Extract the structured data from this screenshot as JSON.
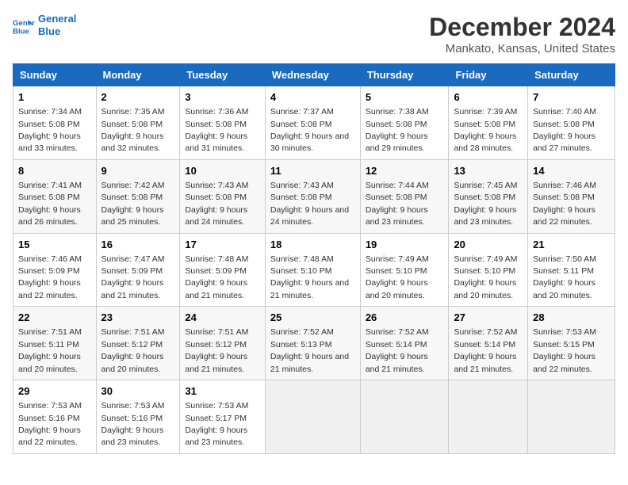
{
  "header": {
    "logo_line1": "General",
    "logo_line2": "Blue",
    "title": "December 2024",
    "subtitle": "Mankato, Kansas, United States"
  },
  "calendar": {
    "days_of_week": [
      "Sunday",
      "Monday",
      "Tuesday",
      "Wednesday",
      "Thursday",
      "Friday",
      "Saturday"
    ],
    "weeks": [
      [
        {
          "day": 1,
          "sunrise": "7:34 AM",
          "sunset": "5:08 PM",
          "daylight": "9 hours and 33 minutes."
        },
        {
          "day": 2,
          "sunrise": "7:35 AM",
          "sunset": "5:08 PM",
          "daylight": "9 hours and 32 minutes."
        },
        {
          "day": 3,
          "sunrise": "7:36 AM",
          "sunset": "5:08 PM",
          "daylight": "9 hours and 31 minutes."
        },
        {
          "day": 4,
          "sunrise": "7:37 AM",
          "sunset": "5:08 PM",
          "daylight": "9 hours and 30 minutes."
        },
        {
          "day": 5,
          "sunrise": "7:38 AM",
          "sunset": "5:08 PM",
          "daylight": "9 hours and 29 minutes."
        },
        {
          "day": 6,
          "sunrise": "7:39 AM",
          "sunset": "5:08 PM",
          "daylight": "9 hours and 28 minutes."
        },
        {
          "day": 7,
          "sunrise": "7:40 AM",
          "sunset": "5:08 PM",
          "daylight": "9 hours and 27 minutes."
        }
      ],
      [
        {
          "day": 8,
          "sunrise": "7:41 AM",
          "sunset": "5:08 PM",
          "daylight": "9 hours and 26 minutes."
        },
        {
          "day": 9,
          "sunrise": "7:42 AM",
          "sunset": "5:08 PM",
          "daylight": "9 hours and 25 minutes."
        },
        {
          "day": 10,
          "sunrise": "7:43 AM",
          "sunset": "5:08 PM",
          "daylight": "9 hours and 24 minutes."
        },
        {
          "day": 11,
          "sunrise": "7:43 AM",
          "sunset": "5:08 PM",
          "daylight": "9 hours and 24 minutes."
        },
        {
          "day": 12,
          "sunrise": "7:44 AM",
          "sunset": "5:08 PM",
          "daylight": "9 hours and 23 minutes."
        },
        {
          "day": 13,
          "sunrise": "7:45 AM",
          "sunset": "5:08 PM",
          "daylight": "9 hours and 23 minutes."
        },
        {
          "day": 14,
          "sunrise": "7:46 AM",
          "sunset": "5:08 PM",
          "daylight": "9 hours and 22 minutes."
        }
      ],
      [
        {
          "day": 15,
          "sunrise": "7:46 AM",
          "sunset": "5:09 PM",
          "daylight": "9 hours and 22 minutes."
        },
        {
          "day": 16,
          "sunrise": "7:47 AM",
          "sunset": "5:09 PM",
          "daylight": "9 hours and 21 minutes."
        },
        {
          "day": 17,
          "sunrise": "7:48 AM",
          "sunset": "5:09 PM",
          "daylight": "9 hours and 21 minutes."
        },
        {
          "day": 18,
          "sunrise": "7:48 AM",
          "sunset": "5:10 PM",
          "daylight": "9 hours and 21 minutes."
        },
        {
          "day": 19,
          "sunrise": "7:49 AM",
          "sunset": "5:10 PM",
          "daylight": "9 hours and 20 minutes."
        },
        {
          "day": 20,
          "sunrise": "7:49 AM",
          "sunset": "5:10 PM",
          "daylight": "9 hours and 20 minutes."
        },
        {
          "day": 21,
          "sunrise": "7:50 AM",
          "sunset": "5:11 PM",
          "daylight": "9 hours and 20 minutes."
        }
      ],
      [
        {
          "day": 22,
          "sunrise": "7:51 AM",
          "sunset": "5:11 PM",
          "daylight": "9 hours and 20 minutes."
        },
        {
          "day": 23,
          "sunrise": "7:51 AM",
          "sunset": "5:12 PM",
          "daylight": "9 hours and 20 minutes."
        },
        {
          "day": 24,
          "sunrise": "7:51 AM",
          "sunset": "5:12 PM",
          "daylight": "9 hours and 21 minutes."
        },
        {
          "day": 25,
          "sunrise": "7:52 AM",
          "sunset": "5:13 PM",
          "daylight": "9 hours and 21 minutes."
        },
        {
          "day": 26,
          "sunrise": "7:52 AM",
          "sunset": "5:14 PM",
          "daylight": "9 hours and 21 minutes."
        },
        {
          "day": 27,
          "sunrise": "7:52 AM",
          "sunset": "5:14 PM",
          "daylight": "9 hours and 21 minutes."
        },
        {
          "day": 28,
          "sunrise": "7:53 AM",
          "sunset": "5:15 PM",
          "daylight": "9 hours and 22 minutes."
        }
      ],
      [
        {
          "day": 29,
          "sunrise": "7:53 AM",
          "sunset": "5:16 PM",
          "daylight": "9 hours and 22 minutes."
        },
        {
          "day": 30,
          "sunrise": "7:53 AM",
          "sunset": "5:16 PM",
          "daylight": "9 hours and 23 minutes."
        },
        {
          "day": 31,
          "sunrise": "7:53 AM",
          "sunset": "5:17 PM",
          "daylight": "9 hours and 23 minutes."
        },
        null,
        null,
        null,
        null
      ]
    ]
  }
}
